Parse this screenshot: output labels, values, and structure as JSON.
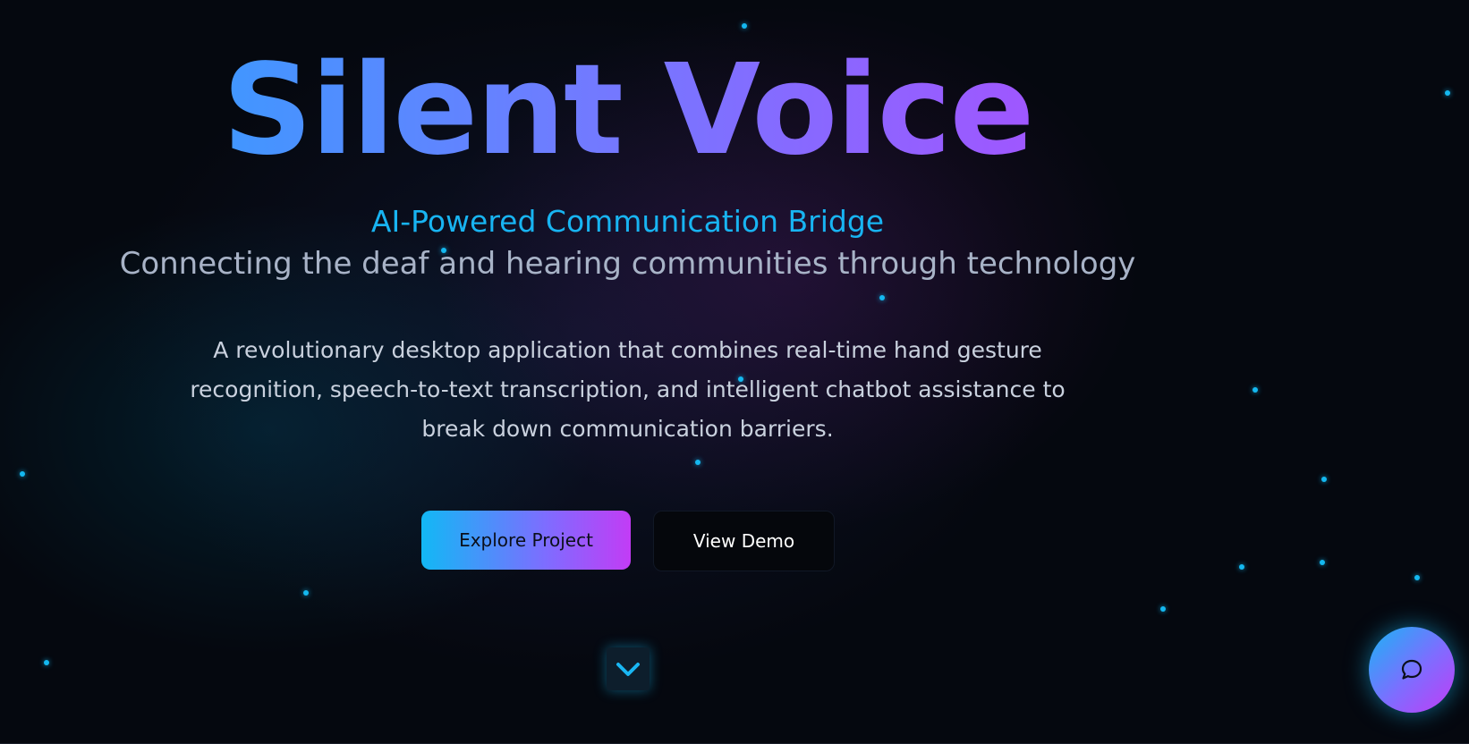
{
  "hero": {
    "title": "Silent Voice",
    "tagline": "AI-Powered Communication Bridge",
    "subtitle": "Connecting the deaf and hearing communities through technology",
    "description": "A revolutionary desktop application that combines real-time hand gesture recognition, speech-to-text transcription, and intelligent chatbot assistance to break down communication barriers."
  },
  "buttons": {
    "primary_label": "Explore Project",
    "secondary_label": "View Demo"
  },
  "icons": {
    "scroll": "chevron-down-icon",
    "chat": "chat-bubble-icon"
  },
  "colors": {
    "background": "#05080f",
    "accent_cyan": "#14b8f0",
    "accent_purple": "#b645ff",
    "tagline": "#18b4f2",
    "subtitle": "#a8b3c7"
  }
}
